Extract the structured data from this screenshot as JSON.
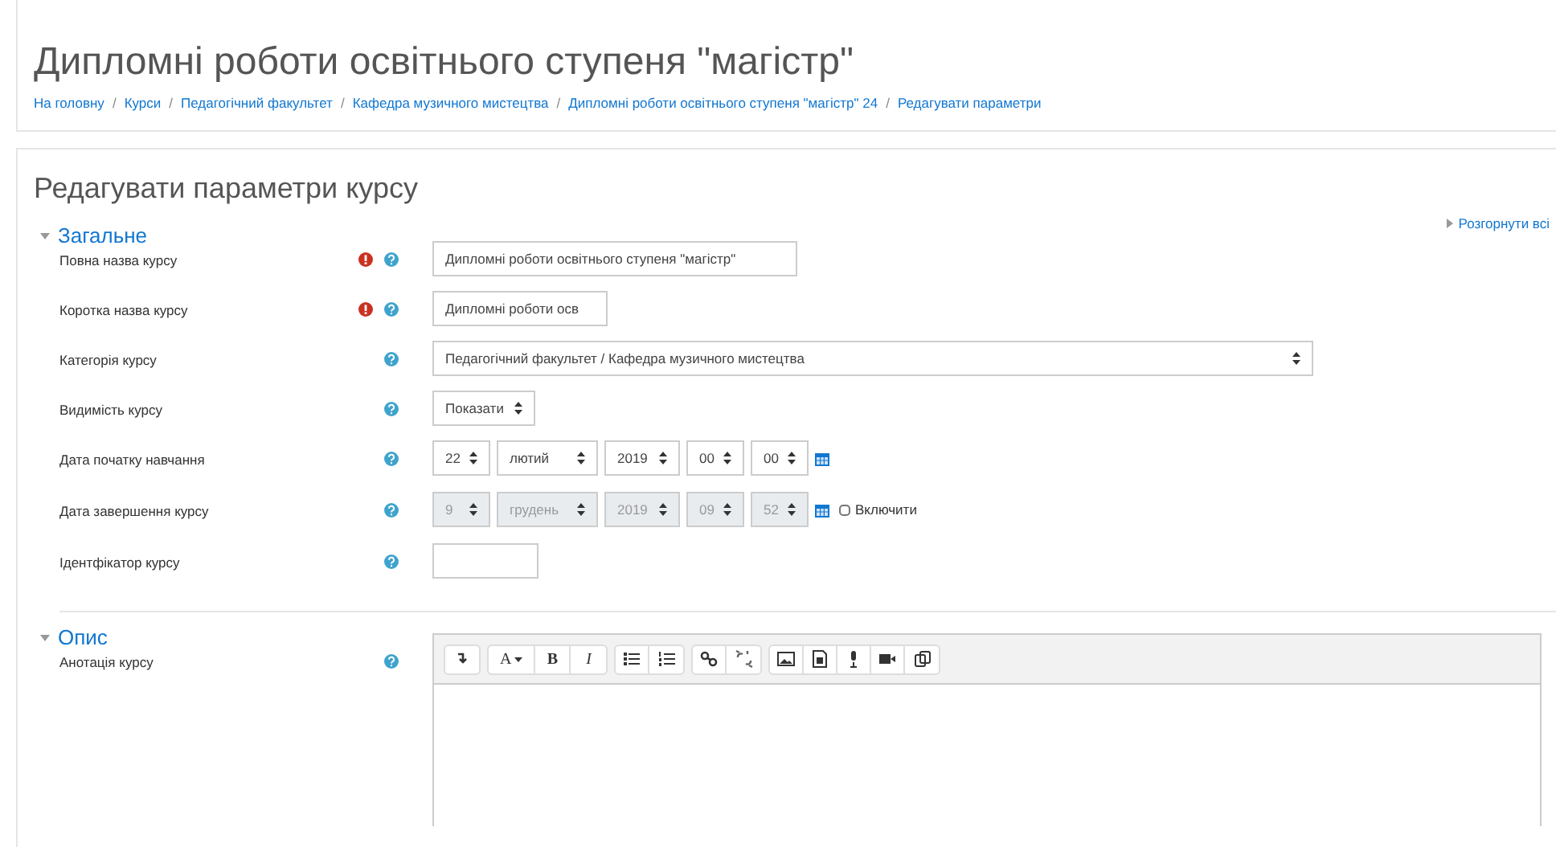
{
  "page_title": "Дипломні роботи освітнього ступеня \"магістр\"",
  "breadcrumb": [
    {
      "label": "На головну",
      "separator": "/"
    },
    {
      "label": "Курси",
      "separator": "/"
    },
    {
      "label": "Педагогічний факультет",
      "separator": "/"
    },
    {
      "label": "Кафедра музичного мистецтва",
      "separator": "/"
    },
    {
      "label": "Дипломні роботи освітнього ступеня \"магістр\" 24",
      "separator": "/"
    },
    {
      "label": "Редагувати параметри"
    }
  ],
  "form_title": "Редагувати параметри курсу",
  "expand_all": "Розгорнути всі",
  "sections": [
    {
      "title": "Загальне",
      "expanded": true,
      "fields": [
        {
          "kind": "text",
          "label": "Повна назва курсу",
          "required": true,
          "value": "Дипломні роботи освітнього ступеня \"магістр\""
        },
        {
          "kind": "text",
          "label": "Коротка назва курсу",
          "required": true,
          "value": "Дипломні роботи осв"
        },
        {
          "kind": "select",
          "label": "Категорія курсу",
          "required": false,
          "value": "Педагогічний факультет / Кафедра музичного мистецтва",
          "wide": true
        },
        {
          "kind": "select",
          "label": "Видимість курсу",
          "required": false,
          "value": "Показати",
          "wide": false
        },
        {
          "kind": "date",
          "label": "Дата початку навчання",
          "required": false,
          "disabled": false,
          "parts": [
            "22",
            "лютий",
            "2019",
            "00",
            "00"
          ]
        },
        {
          "kind": "date",
          "label": "Дата завершення курсу",
          "required": false,
          "disabled": true,
          "parts": [
            "9",
            "грудень",
            "2019",
            "09",
            "52"
          ],
          "enable": {
            "label": "Включити",
            "checked": false
          }
        },
        {
          "kind": "text",
          "label": "Ідентфікатор курсу",
          "required": false
        }
      ]
    },
    {
      "title": "Опис",
      "expanded": true,
      "fields": [
        {
          "kind": "editor",
          "label": "Анотація курсу",
          "required": false,
          "toolbar": [
            [
              {
                "kind": "collapse"
              }
            ],
            [
              {
                "kind": "font",
                "label": "A"
              },
              {
                "kind": "text",
                "label": "B"
              },
              {
                "kind": "text",
                "label": "I"
              }
            ],
            [
              {
                "kind": "bullets"
              },
              {
                "kind": "numbers"
              }
            ],
            [
              {
                "kind": "link"
              },
              {
                "kind": "unlink"
              }
            ],
            [
              {
                "kind": "image"
              },
              {
                "kind": "media"
              },
              {
                "kind": "mic"
              },
              {
                "kind": "video"
              },
              {
                "kind": "copy"
              }
            ]
          ]
        }
      ]
    }
  ]
}
